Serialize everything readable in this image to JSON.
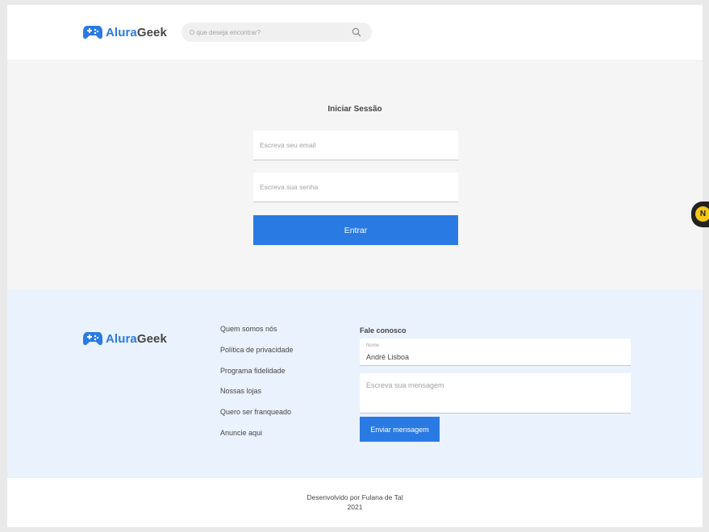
{
  "brand": {
    "name_part1": "Alura",
    "name_part2": "Geek",
    "accent": "#2a7ae4"
  },
  "header": {
    "search_placeholder": "O que deseja encontrar?",
    "search_icon": "search-icon"
  },
  "login": {
    "title": "Iniciar Sessão",
    "email_placeholder": "Escreva seu email",
    "password_placeholder": "Escreva sua senha",
    "submit_label": "Entrar"
  },
  "badge": {
    "letter": "N",
    "color": "#f5c518"
  },
  "footer": {
    "links": [
      "Quem somos nós",
      "Política de privacidade",
      "Programa fidelidade",
      "Nossas lojas",
      "Quero ser franqueado",
      "Anuncie aqui"
    ],
    "contact": {
      "title": "Fale conosco",
      "name_label": "Nome",
      "name_value": "André Lisboa",
      "message_placeholder": "Escreva sua mensagem",
      "send_label": "Enviar mensagem"
    }
  },
  "credit": {
    "line1": "Desenvolvido por Fulana de Tal",
    "line2": "2021"
  }
}
